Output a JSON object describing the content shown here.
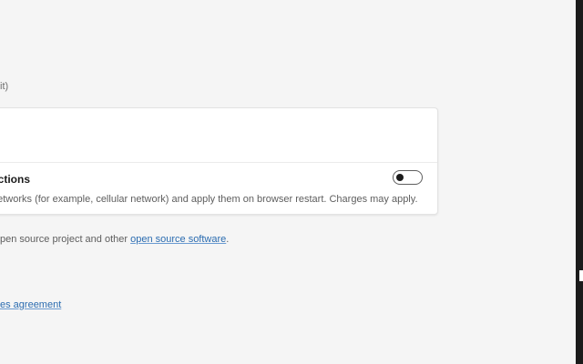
{
  "version_fragment": "it)",
  "settings_card": {
    "title": "ections",
    "description": "networks (for example, cellular network) and apply them on browser restart. Charges may apply.",
    "toggle_on": false
  },
  "oss": {
    "prefix": "pen source project and other ",
    "link": "open source software",
    "suffix": "."
  },
  "agreement_link": "es agreement",
  "colors": {
    "background": "#f5f5f5",
    "card": "#ffffff",
    "link": "#2b6cb0",
    "scrollbar": "#1b1b1b"
  }
}
